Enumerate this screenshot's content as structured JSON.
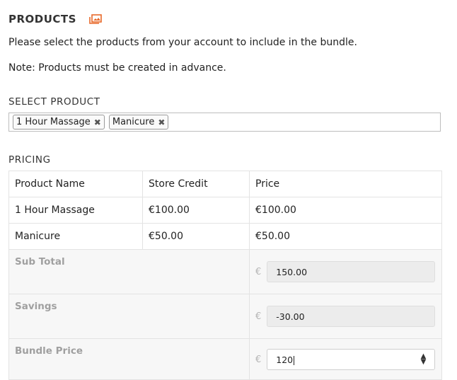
{
  "products": {
    "title": "PRODUCTS",
    "icon": "gallery-icon",
    "description": "Please select the products from your account to include in the bundle.",
    "note": "Note: Products must be created in advance."
  },
  "select_product": {
    "label": "SELECT PRODUCT",
    "tags": [
      "1 Hour Massage",
      "Manicure"
    ]
  },
  "pricing": {
    "label": "PRICING",
    "headers": [
      "Product Name",
      "Store Credit",
      "Price"
    ],
    "rows": [
      {
        "name": "1 Hour Massage",
        "credit": "€100.00",
        "price": "€100.00"
      },
      {
        "name": "Manicure",
        "credit": "€50.00",
        "price": "€50.00"
      }
    ],
    "currency": "€",
    "subtotal": {
      "label": "Sub Total",
      "value": "150.00"
    },
    "savings": {
      "label": "Savings",
      "value": "-30.00"
    },
    "bundle_price": {
      "label": "Bundle Price",
      "value": "120"
    }
  },
  "colors": {
    "accent": "#e8692a"
  }
}
